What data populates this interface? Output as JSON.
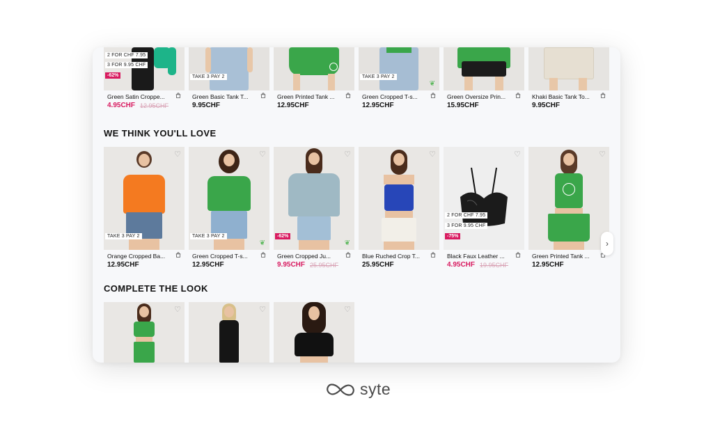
{
  "brand": {
    "logo_text": "syte"
  },
  "colors": {
    "sale": "#d81b60",
    "accent_green": "#3aa64a"
  },
  "top_row": [
    {
      "name": "Green Satin Croppe...",
      "price": "4.95CHF",
      "old_price": "12.95CHF",
      "sale": true,
      "badges": [
        "2 FOR CHF 7.95",
        "3 FOR 9.95 CHF"
      ],
      "discount": "-62%",
      "eco": false
    },
    {
      "name": "Green Basic Tank T...",
      "price": "9.95CHF",
      "old_price": "",
      "sale": false,
      "badges": [
        "TAKE 3 PAY 2"
      ],
      "discount": "",
      "eco": false
    },
    {
      "name": "Green Printed Tank ...",
      "price": "12.95CHF",
      "old_price": "",
      "sale": false,
      "badges": [],
      "discount": "",
      "eco": false
    },
    {
      "name": "Green Cropped T-s...",
      "price": "12.95CHF",
      "old_price": "",
      "sale": false,
      "badges": [
        "TAKE 3 PAY 2"
      ],
      "discount": "",
      "eco": true
    },
    {
      "name": "Green Oversize Prin...",
      "price": "15.95CHF",
      "old_price": "",
      "sale": false,
      "badges": [],
      "discount": "",
      "eco": false
    },
    {
      "name": "Khaki Basic Tank To...",
      "price": "9.95CHF",
      "old_price": "",
      "sale": false,
      "badges": [],
      "discount": "",
      "eco": false
    }
  ],
  "love_section": {
    "title": "WE THINK YOU'LL LOVE",
    "items": [
      {
        "name": "Orange Cropped Ba...",
        "price": "12.95CHF",
        "old_price": "",
        "sale": false,
        "badges": [
          "TAKE 3 PAY 2"
        ],
        "discount": "",
        "eco": false
      },
      {
        "name": "Green Cropped T-s...",
        "price": "12.95CHF",
        "old_price": "",
        "sale": false,
        "badges": [
          "TAKE 3 PAY 2"
        ],
        "discount": "",
        "eco": true
      },
      {
        "name": "Green Cropped Ju...",
        "price": "9.95CHF",
        "old_price": "25.95CHF",
        "sale": true,
        "badges": [],
        "discount": "-62%",
        "eco": true
      },
      {
        "name": "Blue Ruched Crop T...",
        "price": "25.95CHF",
        "old_price": "",
        "sale": false,
        "badges": [],
        "discount": "",
        "eco": false
      },
      {
        "name": "Black Faux Leather ...",
        "price": "4.95CHF",
        "old_price": "19.95CHF",
        "sale": true,
        "badges": [
          "2 FOR CHF 7.95",
          "3 FOR 9.95 CHF"
        ],
        "discount": "-75%",
        "eco": false
      },
      {
        "name": "Green Printed Tank ...",
        "price": "12.95CHF",
        "old_price": "",
        "sale": false,
        "badges": [],
        "discount": "",
        "eco": false
      }
    ],
    "next_icon": "chevron-right-icon"
  },
  "complete_section": {
    "title": "COMPLETE THE LOOK",
    "items": [
      {
        "label": "green-set"
      },
      {
        "label": "black-dress"
      },
      {
        "label": "black-top"
      }
    ]
  }
}
